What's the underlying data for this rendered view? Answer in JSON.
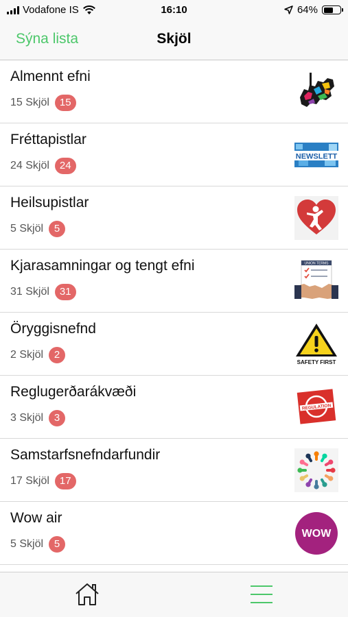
{
  "status_bar": {
    "carrier": "Vodafone IS",
    "time": "16:10",
    "battery": "64%",
    "battery_level": 0.64
  },
  "nav": {
    "back_label": "Sýna lista",
    "title": "Skjöl"
  },
  "list": {
    "items": [
      {
        "title": "Almennt efni",
        "count": "15 Skjöl",
        "badge": "15",
        "thumbnail": "colorful-map-logo"
      },
      {
        "title": "Fréttapistlar",
        "count": "24 Skjöl",
        "badge": "24",
        "thumbnail": "newsletter-banner"
      },
      {
        "title": "Heilsupistlar",
        "count": "5 Skjöl",
        "badge": "5",
        "thumbnail": "health-heart-icon"
      },
      {
        "title": "Kjarasamningar og tengt efni",
        "count": "31 Skjöl",
        "badge": "31",
        "thumbnail": "handshake-contract-icon"
      },
      {
        "title": "Öryggisnefnd",
        "count": "2 Skjöl",
        "badge": "2",
        "thumbnail": "safety-first-sign"
      },
      {
        "title": "Reglugerðarákvæði",
        "count": "3 Skjöl",
        "badge": "3",
        "thumbnail": "regulation-stamp"
      },
      {
        "title": "Samstarfsnefndarfundir",
        "count": "17 Skjöl",
        "badge": "17",
        "thumbnail": "people-circle-icon"
      },
      {
        "title": "Wow air",
        "count": "5 Skjöl",
        "badge": "5",
        "thumbnail": "wow-air-logo"
      }
    ]
  },
  "thumb_text": {
    "newsletter": "NEWSLETT",
    "safety": "SAFETY FIRST",
    "regulation": "REGULATION",
    "wow": "WOW",
    "union": "UNION TERMS"
  },
  "tab_bar": {
    "home_icon": "home-icon",
    "menu_icon": "hamburger-menu-icon",
    "active_color": "#4cc76a"
  },
  "colors": {
    "accent": "#4cc76a",
    "badge": "#e36767"
  }
}
